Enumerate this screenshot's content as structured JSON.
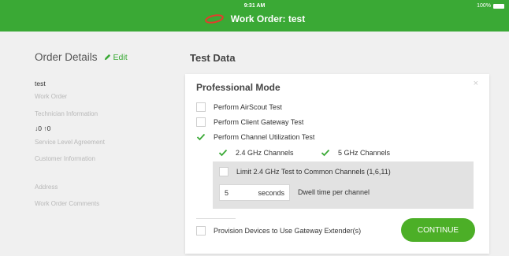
{
  "status_bar": {
    "time": "9:31 AM",
    "battery": "100%"
  },
  "header": {
    "title": "Work Order: test"
  },
  "left_panel": {
    "heading": "Order Details",
    "edit_label": "Edit",
    "work_order_value": "test",
    "work_order_label": "Work Order",
    "technician_label": "Technician Information",
    "sla_value": "↓0  ↑0",
    "sla_label": "Service Level Agreement",
    "customer_label": "Customer Information",
    "address_label": "Address",
    "comments_label": "Work Order Comments"
  },
  "main": {
    "heading": "Test Data",
    "card": {
      "title": "Professional Mode",
      "close": "×",
      "options": {
        "airscout": {
          "label": "Perform AirScout Test",
          "checked": false
        },
        "client_gateway": {
          "label": "Perform Client Gateway Test",
          "checked": false
        },
        "channel_util": {
          "label": "Perform Channel Utilization Test",
          "checked": true
        },
        "ghz24": {
          "label": "2.4 GHz Channels",
          "checked": true
        },
        "ghz5": {
          "label": "5 GHz Channels",
          "checked": true
        },
        "limit24": {
          "label": "Limit 2.4 GHz Test to Common Channels (1,6,11)",
          "checked": false
        },
        "provision": {
          "label": "Provision Devices to Use Gateway Extender(s)",
          "checked": false
        }
      },
      "dwell": {
        "value": "5",
        "unit": "seconds",
        "label": "Dwell time per channel"
      },
      "continue_label": "CONTINUE"
    }
  },
  "colors": {
    "accent": "#3aa935",
    "button": "#4caf27"
  },
  "icons": {
    "logo": "swirl-logo-icon",
    "edit": "pencil-icon",
    "check": "checkmark-icon"
  }
}
